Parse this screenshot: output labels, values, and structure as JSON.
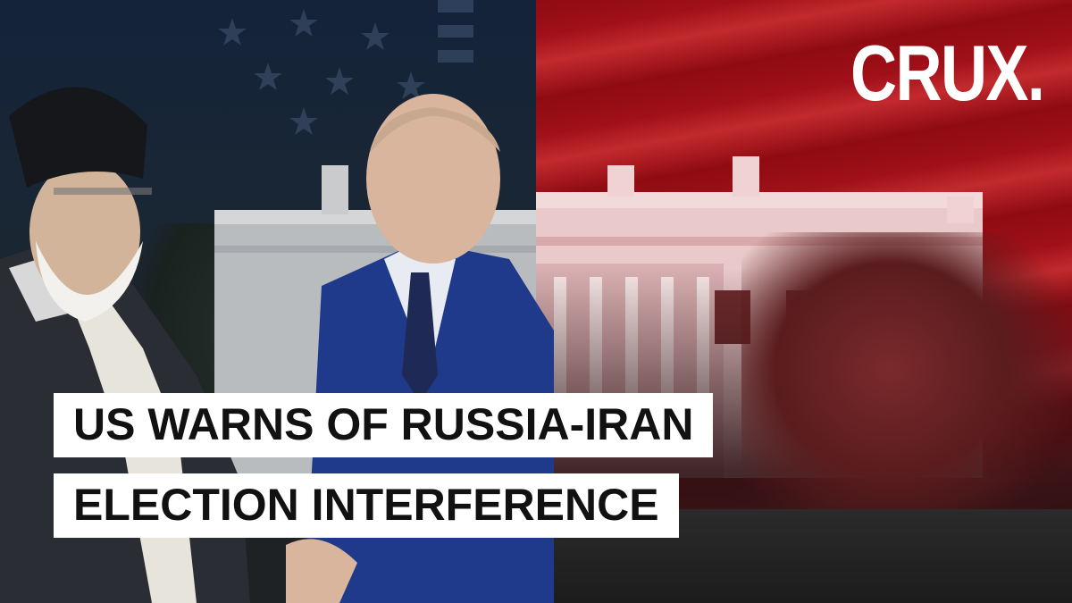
{
  "logo": {
    "text": "CRUX."
  },
  "headline": {
    "line1": "US WARNS OF RUSSIA-IRAN",
    "line2": "ELECTION INTERFERENCE"
  },
  "colors": {
    "flag_red": "#a01018",
    "flag_blue": "#1b2b44",
    "banner_bg": "#ffffff",
    "banner_text": "#111111",
    "suit_blue": "#1f3a8a"
  }
}
